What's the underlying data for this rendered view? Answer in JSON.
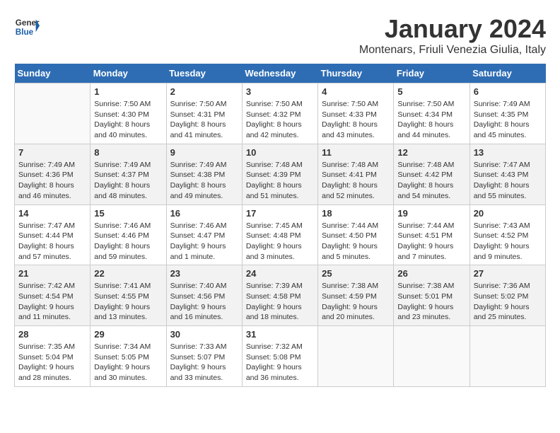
{
  "header": {
    "logo_line1": "General",
    "logo_line2": "Blue",
    "title": "January 2024",
    "subtitle": "Montenars, Friuli Venezia Giulia, Italy"
  },
  "days_of_week": [
    "Sunday",
    "Monday",
    "Tuesday",
    "Wednesday",
    "Thursday",
    "Friday",
    "Saturday"
  ],
  "weeks": [
    [
      {
        "day": "",
        "info": ""
      },
      {
        "day": "1",
        "info": "Sunrise: 7:50 AM\nSunset: 4:30 PM\nDaylight: 8 hours\nand 40 minutes."
      },
      {
        "day": "2",
        "info": "Sunrise: 7:50 AM\nSunset: 4:31 PM\nDaylight: 8 hours\nand 41 minutes."
      },
      {
        "day": "3",
        "info": "Sunrise: 7:50 AM\nSunset: 4:32 PM\nDaylight: 8 hours\nand 42 minutes."
      },
      {
        "day": "4",
        "info": "Sunrise: 7:50 AM\nSunset: 4:33 PM\nDaylight: 8 hours\nand 43 minutes."
      },
      {
        "day": "5",
        "info": "Sunrise: 7:50 AM\nSunset: 4:34 PM\nDaylight: 8 hours\nand 44 minutes."
      },
      {
        "day": "6",
        "info": "Sunrise: 7:49 AM\nSunset: 4:35 PM\nDaylight: 8 hours\nand 45 minutes."
      }
    ],
    [
      {
        "day": "7",
        "info": "Sunrise: 7:49 AM\nSunset: 4:36 PM\nDaylight: 8 hours\nand 46 minutes."
      },
      {
        "day": "8",
        "info": "Sunrise: 7:49 AM\nSunset: 4:37 PM\nDaylight: 8 hours\nand 48 minutes."
      },
      {
        "day": "9",
        "info": "Sunrise: 7:49 AM\nSunset: 4:38 PM\nDaylight: 8 hours\nand 49 minutes."
      },
      {
        "day": "10",
        "info": "Sunrise: 7:48 AM\nSunset: 4:39 PM\nDaylight: 8 hours\nand 51 minutes."
      },
      {
        "day": "11",
        "info": "Sunrise: 7:48 AM\nSunset: 4:41 PM\nDaylight: 8 hours\nand 52 minutes."
      },
      {
        "day": "12",
        "info": "Sunrise: 7:48 AM\nSunset: 4:42 PM\nDaylight: 8 hours\nand 54 minutes."
      },
      {
        "day": "13",
        "info": "Sunrise: 7:47 AM\nSunset: 4:43 PM\nDaylight: 8 hours\nand 55 minutes."
      }
    ],
    [
      {
        "day": "14",
        "info": "Sunrise: 7:47 AM\nSunset: 4:44 PM\nDaylight: 8 hours\nand 57 minutes."
      },
      {
        "day": "15",
        "info": "Sunrise: 7:46 AM\nSunset: 4:46 PM\nDaylight: 8 hours\nand 59 minutes."
      },
      {
        "day": "16",
        "info": "Sunrise: 7:46 AM\nSunset: 4:47 PM\nDaylight: 9 hours\nand 1 minute."
      },
      {
        "day": "17",
        "info": "Sunrise: 7:45 AM\nSunset: 4:48 PM\nDaylight: 9 hours\nand 3 minutes."
      },
      {
        "day": "18",
        "info": "Sunrise: 7:44 AM\nSunset: 4:50 PM\nDaylight: 9 hours\nand 5 minutes."
      },
      {
        "day": "19",
        "info": "Sunrise: 7:44 AM\nSunset: 4:51 PM\nDaylight: 9 hours\nand 7 minutes."
      },
      {
        "day": "20",
        "info": "Sunrise: 7:43 AM\nSunset: 4:52 PM\nDaylight: 9 hours\nand 9 minutes."
      }
    ],
    [
      {
        "day": "21",
        "info": "Sunrise: 7:42 AM\nSunset: 4:54 PM\nDaylight: 9 hours\nand 11 minutes."
      },
      {
        "day": "22",
        "info": "Sunrise: 7:41 AM\nSunset: 4:55 PM\nDaylight: 9 hours\nand 13 minutes."
      },
      {
        "day": "23",
        "info": "Sunrise: 7:40 AM\nSunset: 4:56 PM\nDaylight: 9 hours\nand 16 minutes."
      },
      {
        "day": "24",
        "info": "Sunrise: 7:39 AM\nSunset: 4:58 PM\nDaylight: 9 hours\nand 18 minutes."
      },
      {
        "day": "25",
        "info": "Sunrise: 7:38 AM\nSunset: 4:59 PM\nDaylight: 9 hours\nand 20 minutes."
      },
      {
        "day": "26",
        "info": "Sunrise: 7:38 AM\nSunset: 5:01 PM\nDaylight: 9 hours\nand 23 minutes."
      },
      {
        "day": "27",
        "info": "Sunrise: 7:36 AM\nSunset: 5:02 PM\nDaylight: 9 hours\nand 25 minutes."
      }
    ],
    [
      {
        "day": "28",
        "info": "Sunrise: 7:35 AM\nSunset: 5:04 PM\nDaylight: 9 hours\nand 28 minutes."
      },
      {
        "day": "29",
        "info": "Sunrise: 7:34 AM\nSunset: 5:05 PM\nDaylight: 9 hours\nand 30 minutes."
      },
      {
        "day": "30",
        "info": "Sunrise: 7:33 AM\nSunset: 5:07 PM\nDaylight: 9 hours\nand 33 minutes."
      },
      {
        "day": "31",
        "info": "Sunrise: 7:32 AM\nSunset: 5:08 PM\nDaylight: 9 hours\nand 36 minutes."
      },
      {
        "day": "",
        "info": ""
      },
      {
        "day": "",
        "info": ""
      },
      {
        "day": "",
        "info": ""
      }
    ]
  ]
}
